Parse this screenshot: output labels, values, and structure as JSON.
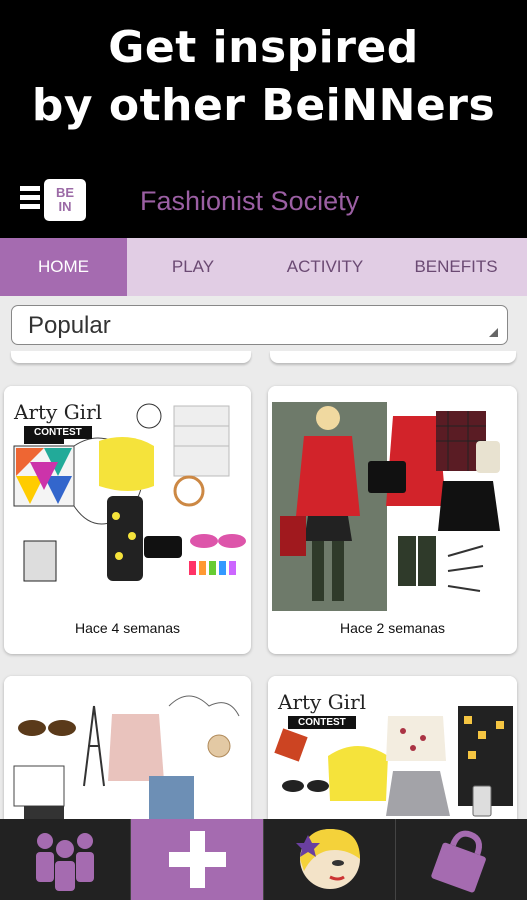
{
  "promo": {
    "line1": "Get inspired",
    "line2": "by other BeiNNers"
  },
  "appbar": {
    "logo_text_top": "BE",
    "logo_text_bottom": "IN",
    "title": "Fashionist Society"
  },
  "tabs": [
    {
      "label": "HOME",
      "active": true
    },
    {
      "label": "PLAY",
      "active": false
    },
    {
      "label": "ACTIVITY",
      "active": false
    },
    {
      "label": "BENEFITS",
      "active": false
    }
  ],
  "filter": {
    "selected": "Popular"
  },
  "cards": [
    {
      "contest_title": "Arty Girl",
      "contest_badge": "CONTEST",
      "time": "Hace 4 semanas"
    },
    {
      "time": "Hace 2 semanas"
    },
    {
      "time": ""
    },
    {
      "contest_title": "Arty Girl",
      "contest_badge": "CONTEST",
      "time": ""
    }
  ],
  "colors": {
    "accent": "#a56bb0",
    "tab_bar": "#e1cde4",
    "title": "#9b5fa3",
    "nav_bg": "#222222"
  },
  "bottom_nav": [
    {
      "icon": "people-icon"
    },
    {
      "icon": "plus-icon"
    },
    {
      "icon": "avatar-face-icon"
    },
    {
      "icon": "shopping-bag-icon"
    }
  ]
}
